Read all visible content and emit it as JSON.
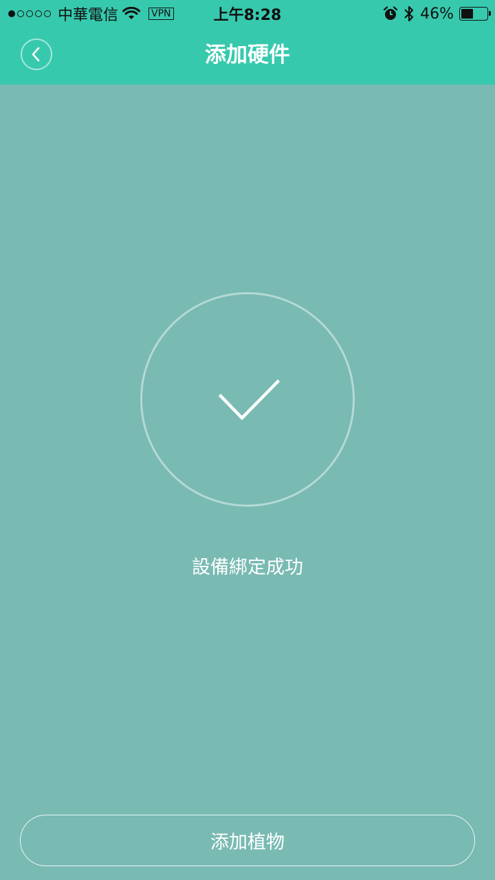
{
  "status_bar": {
    "carrier": "中華電信",
    "signal_dots_filled": 1,
    "signal_dots_total": 5,
    "wifi_icon": "wifi-icon",
    "vpn_label": "VPN",
    "time": "上午8:28",
    "alarm_icon": "alarm-icon",
    "bluetooth_icon": "bluetooth-icon",
    "battery_percent_label": "46%",
    "battery_level": 0.46
  },
  "nav": {
    "back_icon": "chevron-left-icon",
    "title": "添加硬件"
  },
  "main": {
    "success_icon": "checkmark-icon",
    "status_text": "設備綁定成功"
  },
  "footer": {
    "add_plant_label": "添加植物"
  },
  "colors": {
    "header": "#37c9ad",
    "background": "#79bab3",
    "text_light": "#ffffff"
  }
}
